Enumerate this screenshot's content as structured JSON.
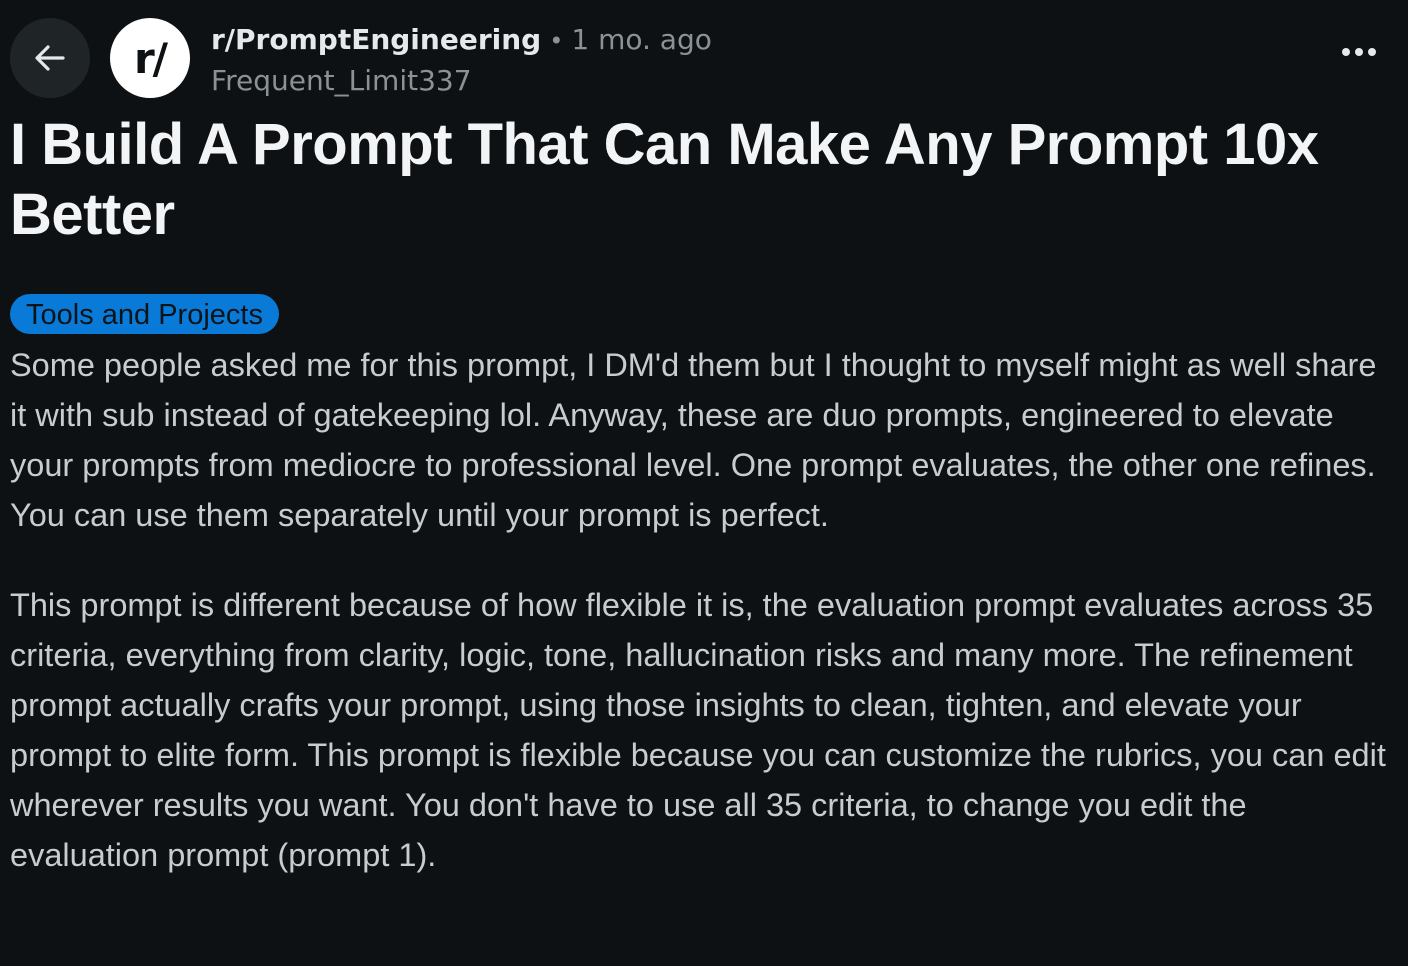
{
  "header": {
    "back_icon": "arrow-left-icon",
    "avatar_text": "r/",
    "subreddit": "r/PromptEngineering",
    "separator": "•",
    "time_ago": "1 mo. ago",
    "author": "Frequent_Limit337",
    "more_icon": "more-horizontal-icon"
  },
  "post": {
    "title": "I Build A Prompt That Can Make Any Prompt 10x Better",
    "flair": "Tools and Projects",
    "flair_color": "#0a7ad9",
    "paragraphs": [
      "Some people asked me for this prompt, I DM'd them but I thought to myself might as well share it with sub instead of gatekeeping lol. Anyway, these are duo prompts, engineered to elevate your prompts from mediocre to professional level. One prompt evaluates, the other one refines. You can use them separately until your prompt is perfect.",
      "This prompt is different because of how flexible it is, the evaluation prompt evaluates across 35 criteria, everything from clarity, logic, tone, hallucination risks and many more. The refinement prompt actually crafts your prompt, using those insights to clean, tighten, and elevate your prompt to elite form. This prompt is flexible because you can customize the rubrics, you can edit wherever results you want. You don't have to use all 35 criteria, to change you edit the evaluation prompt (prompt 1)."
    ]
  },
  "colors": {
    "background": "#0e1113",
    "back_button_bg": "#1f2427",
    "text_primary": "#f2f4f5",
    "text_secondary": "#8b9296"
  }
}
